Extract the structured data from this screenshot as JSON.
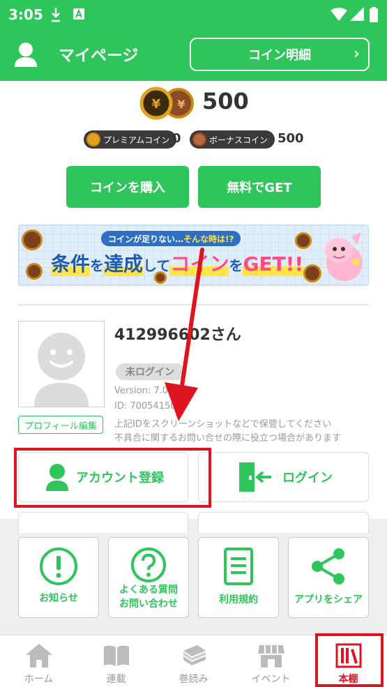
{
  "status_bar": {
    "time": "3:05",
    "icons": [
      "download-icon",
      "notification-a-icon",
      "wifi-icon",
      "signal-icon",
      "battery-icon"
    ]
  },
  "header": {
    "title": "マイページ",
    "coin_detail_label": "コイン明細"
  },
  "coins": {
    "total": "500",
    "premium_label": "プレミアムコイン",
    "premium_value": "0",
    "bonus_label": "ボーナスコイン",
    "bonus_value": "500"
  },
  "buttons": {
    "buy_coins": "コインを購入",
    "get_free": "無料でGET"
  },
  "banner": {
    "pill_prefix": "コインが足りない…",
    "pill_highlight": "そんな時は!?",
    "text_1": "条件",
    "text_2": "を",
    "text_3": "達成",
    "text_4": "して",
    "text_5": "コイン",
    "text_6": "を",
    "text_7": "GET!!"
  },
  "profile": {
    "user_name": "412996602さん",
    "login_status": "未ログイン",
    "version": "Version: 7.08.00",
    "id": "ID: 70054150",
    "note_1": "上記IDをスクリーンショットなどで保管してください",
    "note_2": "不具合に関するお問い合せの際に役立つ場合があります",
    "edit_label": "プロフィール編集"
  },
  "account": {
    "register_label": "アカウント登録",
    "login_label": "ログイン"
  },
  "tiles": [
    {
      "label": "お知らせ",
      "icon": "exclamation-circle-icon"
    },
    {
      "label_1": "よくある質問",
      "label_2": "お問い合わせ",
      "icon": "question-circle-icon"
    },
    {
      "label": "利用規約",
      "icon": "document-icon"
    },
    {
      "label": "アプリをシェア",
      "icon": "share-icon"
    }
  ],
  "nav": [
    {
      "label": "ホーム",
      "icon": "home-icon"
    },
    {
      "label": "連載",
      "icon": "book-open-icon"
    },
    {
      "label": "巻読み",
      "icon": "book-stack-icon"
    },
    {
      "label": "イベント",
      "icon": "shop-awning-icon"
    },
    {
      "label": "本棚",
      "icon": "bookshelf-icon",
      "active": true
    }
  ],
  "colors": {
    "brand_green": "#2ec55a",
    "annotation_red": "#e0141e",
    "coin_gold": "#e2a321"
  }
}
